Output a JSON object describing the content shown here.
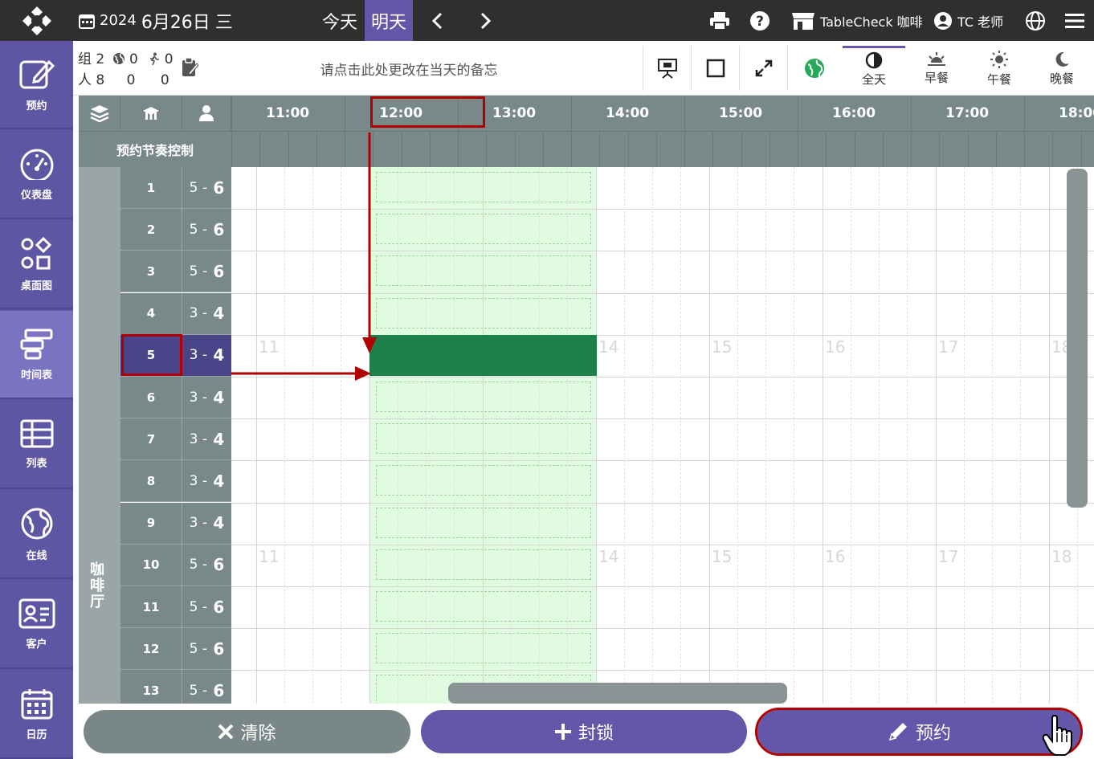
{
  "topbar": {
    "year": "2024",
    "date": "6月26日",
    "weekday": "三",
    "today": "今天",
    "tomorrow": "明天",
    "store": "TableCheck 咖啡",
    "user": "TC 老师"
  },
  "sidebar": [
    {
      "label": "预约",
      "icon": "edit-icon"
    },
    {
      "label": "仪表盘",
      "icon": "dashboard-icon"
    },
    {
      "label": "桌面图",
      "icon": "floor-plan-icon"
    },
    {
      "label": "时间表",
      "icon": "timetable-icon"
    },
    {
      "label": "列表",
      "icon": "list-icon"
    },
    {
      "label": "在线",
      "icon": "globe-icon"
    },
    {
      "label": "客户",
      "icon": "customer-card-icon"
    },
    {
      "label": "日历",
      "icon": "calendar-icon"
    }
  ],
  "toolbar": {
    "groups_label": "组",
    "groups": "2",
    "web_count": "0",
    "walkin_count": "0",
    "people_label": "人",
    "people": "8",
    "people_web": "0",
    "people_walkin": "0",
    "memo": "请点击此处更改在当天的备忘",
    "meals": [
      "全天",
      "早餐",
      "午餐",
      "晚餐"
    ]
  },
  "grid": {
    "times": [
      "11:00",
      "12:00",
      "13:00",
      "14:00",
      "15:00",
      "16:00",
      "17:00",
      "18:00"
    ],
    "pacing_label": "预约节奏控制",
    "area": "咖啡厅",
    "ghost_hours": [
      "11",
      "14",
      "15",
      "16",
      "17",
      "18"
    ],
    "tables": [
      {
        "num": "1",
        "min": "5",
        "max": "6"
      },
      {
        "num": "2",
        "min": "5",
        "max": "6"
      },
      {
        "num": "3",
        "min": "5",
        "max": "6"
      },
      {
        "num": "4",
        "min": "3",
        "max": "4"
      },
      {
        "num": "5",
        "min": "3",
        "max": "4"
      },
      {
        "num": "6",
        "min": "3",
        "max": "4"
      },
      {
        "num": "7",
        "min": "3",
        "max": "4"
      },
      {
        "num": "8",
        "min": "3",
        "max": "4"
      },
      {
        "num": "9",
        "min": "3",
        "max": "4"
      },
      {
        "num": "10",
        "min": "5",
        "max": "6"
      },
      {
        "num": "11",
        "min": "5",
        "max": "6"
      },
      {
        "num": "12",
        "min": "5",
        "max": "6"
      },
      {
        "num": "13",
        "min": "5",
        "max": "6"
      }
    ]
  },
  "actions": {
    "clear": "清除",
    "block": "封锁",
    "book": "预约"
  }
}
